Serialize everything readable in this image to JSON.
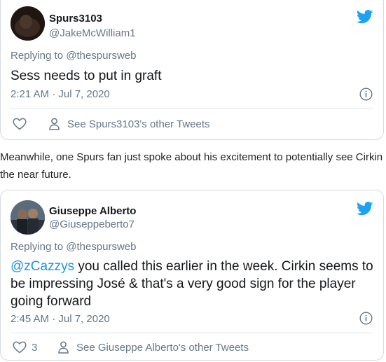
{
  "tweets": [
    {
      "author_name": "Spurs3103",
      "author_handle": "@JakeMcWilliam1",
      "replying_to_prefix": "Replying to ",
      "replying_to_handle": "@thespursweb",
      "text": "Sess needs to put in graft",
      "timestamp": "2:21 AM · Jul 7, 2020",
      "like_count": "",
      "other_tweets_label": "See Spurs3103's other Tweets"
    },
    {
      "author_name": "Giuseppe Alberto",
      "author_handle": "@Giuseppeberto7",
      "replying_to_prefix": "Replying to ",
      "replying_to_handle": "@thespursweb",
      "text_mention": "@zCazzys",
      "text_line1_rest": " you called this earlier in the week. Cirkin seems to",
      "text_line2": "be impressing José & that's a very good sign for the player",
      "text_line3": "going forward",
      "timestamp": "2:45 AM · Jul 7, 2020",
      "like_count": "3",
      "other_tweets_label": "See Giuseppe Alberto's other Tweets"
    }
  ],
  "article": {
    "line1": "Meanwhile, one Spurs fan just spoke about his excitement to potentially see Cirkin i",
    "line2": "the near future."
  },
  "colors": {
    "twitter_blue": "#1da1f2",
    "mention_blue": "#1b95e0",
    "secondary_text": "#657786",
    "card_border": "#d6dbe0"
  },
  "icons": {
    "brand": "twitter-bird-icon",
    "info": "info-icon",
    "like": "heart-icon",
    "profile": "person-icon"
  }
}
